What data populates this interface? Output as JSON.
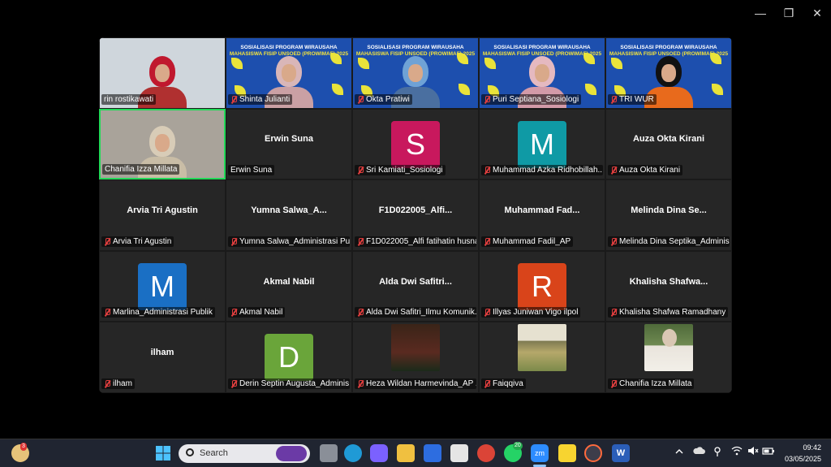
{
  "window": {
    "controls": {
      "minimize": "—",
      "maximize": "❐",
      "close": "✕"
    }
  },
  "banner": {
    "line1": "SOSIALISASI PROGRAM WIRAUSAHA",
    "line2": "MAHASISWA FISIP UNSOED (PROWIMAF) 2025"
  },
  "participants": [
    {
      "label": "rin rostikawati",
      "type": "video",
      "muted": false,
      "bg": "#cfd6dc",
      "hijab": "#c0182e",
      "shirt": "#b03030"
    },
    {
      "label": "Shinta Julianti",
      "type": "banner",
      "muted": true,
      "hijab": "#d9b6b8",
      "shirt": "#caa0a4"
    },
    {
      "label": "Okta Pratiwi",
      "type": "banner",
      "muted": true,
      "hijab": "#6fa2d6",
      "shirt": "#4a6fa0"
    },
    {
      "label": "Puri Septiana_Sosiologi",
      "type": "banner",
      "muted": true,
      "hijab": "#e5b9c0",
      "shirt": "#d39aa8"
    },
    {
      "label": "TRI WUR",
      "type": "banner",
      "muted": true,
      "hijab": "#111111",
      "shirt": "#e86a1c"
    },
    {
      "label": "Chanifia Izza Millata",
      "type": "video",
      "muted": false,
      "active": true,
      "bg": "#a9a39a",
      "hijab": "#d8ccb7",
      "shirt": "#c9bda6"
    },
    {
      "label": "Erwin Suna",
      "center": "Erwin Suna",
      "type": "name",
      "muted": false
    },
    {
      "label": "Sri Kamiati_Sosiologi",
      "type": "avatar",
      "letter": "S",
      "color": "#c8185d",
      "muted": true
    },
    {
      "label": "Muhammad Azka Ridhobillah...",
      "type": "avatar",
      "letter": "M",
      "color": "#0f9aa5",
      "muted": true
    },
    {
      "label": "Auza Okta Kirani",
      "center": "Auza Okta Kirani",
      "type": "name",
      "muted": true
    },
    {
      "label": "Arvia Tri Agustin",
      "center": "Arvia Tri Agustin",
      "type": "name",
      "muted": true
    },
    {
      "label": "Yumna Salwa_Administrasi Pu...",
      "center": "Yumna  Salwa_A...",
      "type": "name",
      "muted": true
    },
    {
      "label": "F1D022005_Alfi fatihatin husna",
      "center": "F1D022005_Alfi...",
      "type": "name",
      "muted": true
    },
    {
      "label": "Muhammad Fadil_AP",
      "center": "Muhammad  Fad...",
      "type": "name",
      "muted": true
    },
    {
      "label": "Melinda Dina Septika_Adminis...",
      "center": "Melinda  Dina  Se...",
      "type": "name",
      "muted": true
    },
    {
      "label": "Marlina_Administrasi Publik",
      "type": "avatar",
      "letter": "M",
      "color": "#1a6fc4",
      "muted": true
    },
    {
      "label": "Akmal Nabil",
      "center": "Akmal Nabil",
      "type": "name",
      "muted": true
    },
    {
      "label": "Alda Dwi Safitri_Ilmu Komunik...",
      "center": "Alda  Dwi  Safitri...",
      "type": "name",
      "muted": true
    },
    {
      "label": "Illyas Juniwan Vigo ilpol",
      "type": "avatar",
      "letter": "R",
      "color": "#d9441a",
      "muted": true
    },
    {
      "label": "Khalisha Shafwa Ramadhany",
      "center": "Khalisha  Shafwa...",
      "type": "name",
      "muted": true
    },
    {
      "label": "ilham",
      "center": "ilham",
      "type": "name",
      "muted": true
    },
    {
      "label": "Derin Septin Augusta_Adminis...",
      "type": "avatar",
      "letter": "D",
      "color": "#6aa53a",
      "muted": true
    },
    {
      "label": "Heza Wildan Harmevinda_AP ...",
      "type": "thumb",
      "thumb": "stage",
      "muted": true
    },
    {
      "label": "Faiqqiva",
      "type": "thumb",
      "thumb": "field",
      "muted": true
    },
    {
      "label": "Chanifia Izza Millata",
      "type": "thumb",
      "thumb": "portrait",
      "muted": true
    }
  ],
  "taskbar": {
    "search_placeholder": "Search",
    "notification_badge": "3",
    "whatsapp_badge": "20",
    "zoom_label": "zm",
    "time": "09:42",
    "date": "03/05/2025"
  }
}
